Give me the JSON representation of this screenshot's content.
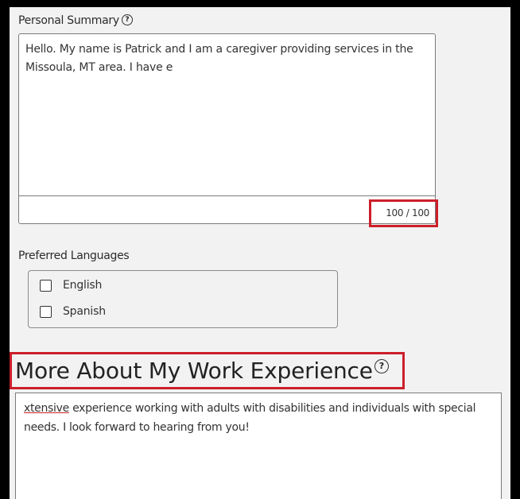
{
  "summary": {
    "label": "Personal Summary",
    "help_icon": "question-circle-icon",
    "text": "Hello. My name is Patrick and I am a caregiver providing services in the Missoula, MT area. I have e",
    "counter": "100 / 100"
  },
  "languages": {
    "label": "Preferred Languages",
    "options": [
      {
        "label": "English",
        "checked": false
      },
      {
        "label": "Spanish",
        "checked": false
      }
    ]
  },
  "work": {
    "heading": "More About My Work Experience",
    "help_icon": "question-circle-icon",
    "misspelled_word": "xtensive",
    "text_rest": " experience working with adults with disabilities and individuals with special needs. I look forward to hearing from you!"
  },
  "colors": {
    "highlight": "#cc1f2b",
    "background": "#f2f2f2",
    "frame": "#000000"
  }
}
